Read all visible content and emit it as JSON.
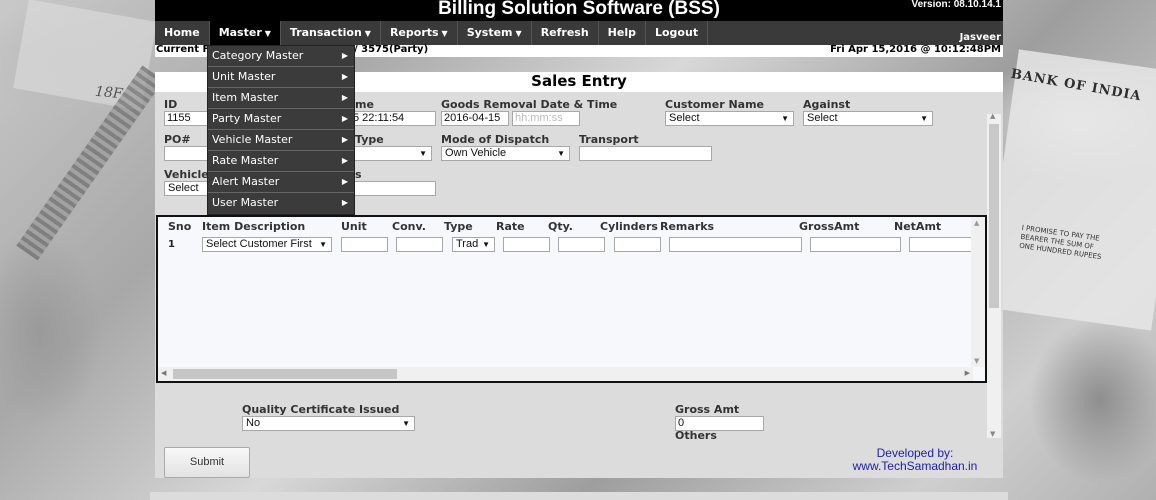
{
  "app": {
    "title": "Billing Solution Software (BSS)",
    "version": "Version: 08.10.14.1",
    "user": "Jasveer",
    "current_label": "Current F",
    "current_value": "/ 3575(Party)",
    "datetime": "Fri Apr 15,2016 @ 10:12:48PM"
  },
  "nav": [
    {
      "label": "Home",
      "caret": ""
    },
    {
      "label": "Master",
      "caret": "▼"
    },
    {
      "label": "Transaction",
      "caret": "▼"
    },
    {
      "label": "Reports",
      "caret": "▼"
    },
    {
      "label": "System",
      "caret": "▼"
    },
    {
      "label": "Refresh",
      "caret": ""
    },
    {
      "label": "Help",
      "caret": ""
    },
    {
      "label": "Logout",
      "caret": ""
    }
  ],
  "master_menu": [
    {
      "label": "Category Master",
      "arrow": "▶"
    },
    {
      "label": "Unit Master",
      "arrow": "▶"
    },
    {
      "label": "Item Master",
      "arrow": "▶"
    },
    {
      "label": "Party Master",
      "arrow": "▶"
    },
    {
      "label": "Vehicle Master",
      "arrow": "▶"
    },
    {
      "label": "Rate Master",
      "arrow": "▶"
    },
    {
      "label": "Alert Master",
      "arrow": "▶"
    },
    {
      "label": "User Master",
      "arrow": "▶"
    }
  ],
  "page_title": "Sales Entry",
  "form": {
    "id_label": "ID",
    "id_value": "1155",
    "datetime_label_tail": "me",
    "datetime_value": "5 22:11:54",
    "goods_removal_label": "Goods Removal Date & Time",
    "goods_removal_date": "2016-04-15",
    "goods_removal_time_placeholder": "hh:mm:ss",
    "customer_name_label": "Customer Name",
    "customer_name_value": "Select",
    "against_label": "Against",
    "against_value": "Select",
    "po_label": "PO#",
    "po_value": "",
    "type_label_tail": "Type",
    "type_value": "",
    "mode_dispatch_label": "Mode of Dispatch",
    "mode_dispatch_value": "Own Vehicle",
    "transport_label": "Transport",
    "transport_value": "",
    "vehicle_label": "Vehicle",
    "vehicle_value": "Select",
    "hidden_label_tail": "s",
    "hidden_value": "",
    "dropdown_caret": "▼"
  },
  "grid": {
    "headers": [
      "Sno",
      "Item Description",
      "Unit",
      "Conv.",
      "Type",
      "Rate",
      "Qty.",
      "Cylinders",
      "Remarks",
      "GrossAmt",
      "NetAmt"
    ],
    "rows": [
      {
        "sno": "1",
        "item": "Select Customer First",
        "unit": "",
        "conv": "",
        "type": "Trad",
        "rate": "",
        "qty": "",
        "cylinders": "",
        "remarks": "",
        "gross": "",
        "net": ""
      }
    ],
    "scroll_up": "▲",
    "scroll_down": "▼",
    "scroll_left": "◀",
    "scroll_right": "▶"
  },
  "footer_form": {
    "quality_label": "Quality Certificate Issued",
    "quality_value": "No",
    "gross_amt_label": "Gross Amt",
    "gross_amt_value": "0",
    "others_label": "Others"
  },
  "submit_label": "Submit",
  "developer": {
    "line1": "Developed by:",
    "line2": "www.TechSamadhan.in"
  },
  "background": {
    "rbi_text": "BANK OF INDIA",
    "promise_text": "I PROMISE TO PAY THE BEARER THE SUM OF ONE HUNDRED RUPEES",
    "note_code": "18F"
  }
}
